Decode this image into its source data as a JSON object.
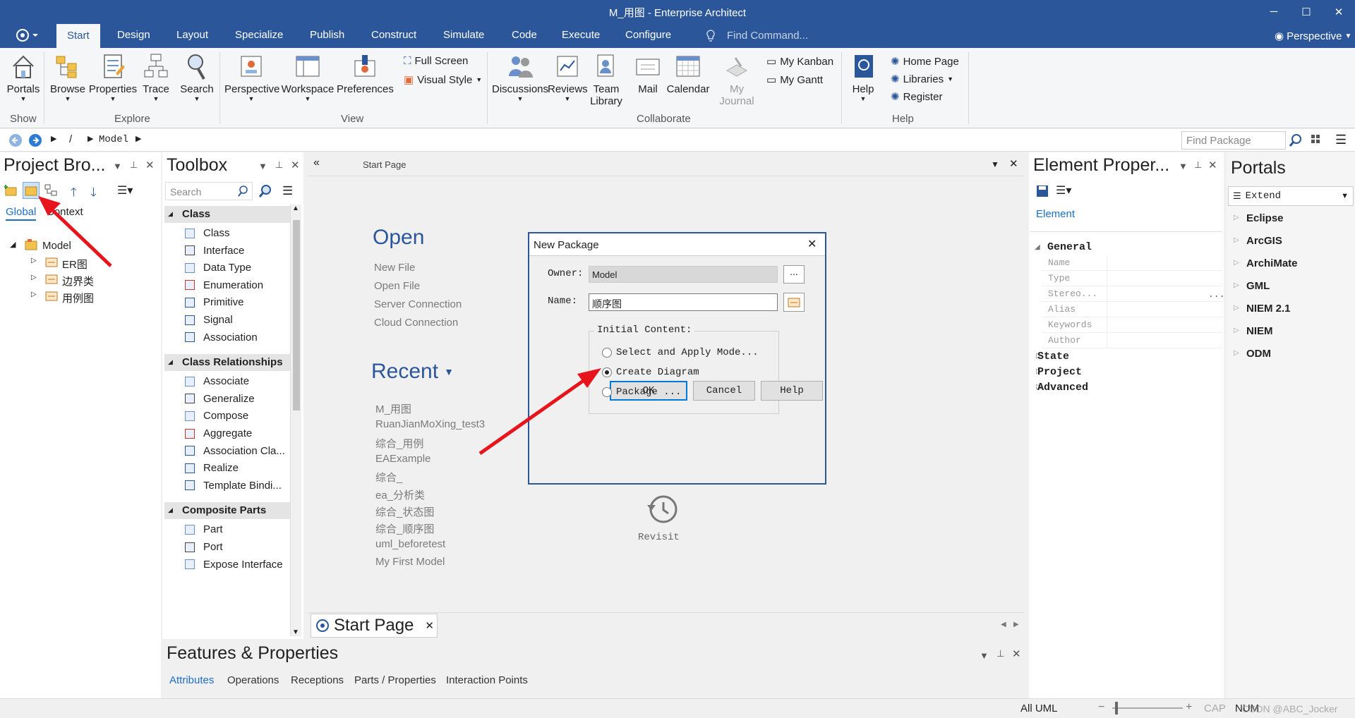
{
  "window": {
    "title": "M_用图 - Enterprise Architect",
    "controls": [
      "─",
      "☐",
      "✕"
    ]
  },
  "ribbon_tabs": [
    "Start",
    "Design",
    "Layout",
    "Specialize",
    "Publish",
    "Construct",
    "Simulate",
    "Code",
    "Execute",
    "Configure"
  ],
  "find_command": {
    "placeholder": "Find Command..."
  },
  "perspective": "Perspective",
  "ribbon": {
    "show": {
      "portals": "Portals",
      "group": "Show"
    },
    "explore": {
      "browse": "Browse",
      "properties": "Properties",
      "trace": "Trace",
      "search": "Search",
      "group": "Explore"
    },
    "view": {
      "perspective": "Perspective",
      "workspace": "Workspace",
      "preferences": "Preferences",
      "full_screen": "Full Screen",
      "visual_style": "Visual Style",
      "group": "View"
    },
    "collaborate": {
      "discussions": "Discussions",
      "reviews": "Reviews",
      "team": "Team",
      "library": "Library",
      "mail": "Mail",
      "calendar": "Calendar",
      "my": "My",
      "journal": "Journal",
      "my_kanban": "My Kanban",
      "my_gantt": "My Gantt",
      "group": "Collaborate"
    },
    "help": {
      "help": "Help",
      "home_page": "Home Page",
      "libraries": "Libraries",
      "register": "Register",
      "group": "Help"
    }
  },
  "address": {
    "path_sep": "/",
    "node": "Model",
    "find_package_placeholder": "Find Package"
  },
  "project_browser": {
    "title": "Project Bro...",
    "tabs": [
      "Global",
      "Context"
    ],
    "root": "Model",
    "children": [
      "ER图",
      "边界类",
      "用例图"
    ]
  },
  "toolbox": {
    "title": "Toolbox",
    "search_placeholder": "Search",
    "sections": [
      {
        "name": "Class",
        "items": [
          "Class",
          "Interface",
          "Data Type",
          "Enumeration",
          "Primitive",
          "Signal",
          "Association"
        ]
      },
      {
        "name": "Class Relationships",
        "items": [
          "Associate",
          "Generalize",
          "Compose",
          "Aggregate",
          "Association Cla...",
          "Realize",
          "Template Bindi..."
        ]
      },
      {
        "name": "Composite Parts",
        "items": [
          "Part",
          "Port",
          "Expose Interface"
        ]
      }
    ]
  },
  "start_page": {
    "header": "Start Page",
    "open_title": "Open",
    "open_links": [
      "New File",
      "Open File",
      "Server Connection",
      "Cloud Connection"
    ],
    "recent_title": "Recent",
    "recent_items": [
      "M_用图",
      "RuanJianMoXing_test3",
      "综合_用例",
      "EAExample",
      "综合_",
      "ea_分析类",
      "综合_状态图",
      "综合_顺序图",
      "uml_beforetest",
      "My First Model"
    ],
    "revisit": "Revisit",
    "tab": "Start Page"
  },
  "dialog": {
    "title": "New Package",
    "owner_label": "Owner:",
    "owner_value": "Model",
    "browse_btn": "...",
    "name_label": "Name:",
    "name_value": "顺序图",
    "initial_content_label": "Initial Content:",
    "options": [
      "Select and Apply Mode...",
      "Create Diagram",
      "Package ..."
    ],
    "selected_option": "Create Diagram",
    "ok": "OK",
    "cancel": "Cancel",
    "help": "Help"
  },
  "element_properties": {
    "title": "Element Proper...",
    "tab": "Element",
    "general": "General",
    "fields": [
      "Name",
      "Type",
      "Stereo...",
      "Alias",
      "Keywords",
      "Author"
    ],
    "stereo_value": "...",
    "groups": [
      "State",
      "Project",
      "Advanced"
    ]
  },
  "portals": {
    "title": "Portals",
    "dropdown": "Extend",
    "items": [
      "Eclipse",
      "ArcGIS",
      "ArchiMate",
      "GML",
      "NIEM 2.1",
      "NIEM",
      "ODM"
    ]
  },
  "features": {
    "title": "Features & Properties",
    "tabs": [
      "Attributes",
      "Operations",
      "Receptions",
      "Parts / Properties",
      "Interaction Points"
    ]
  },
  "status": {
    "mode": "All UML",
    "cap": "CAP",
    "num": "NUM",
    "watermark": "CSDN @ABC_Jocker"
  },
  "colors": {
    "accent": "#2b579a",
    "arrow": "#e8141b",
    "selected_tab": "#1a6fc9"
  }
}
